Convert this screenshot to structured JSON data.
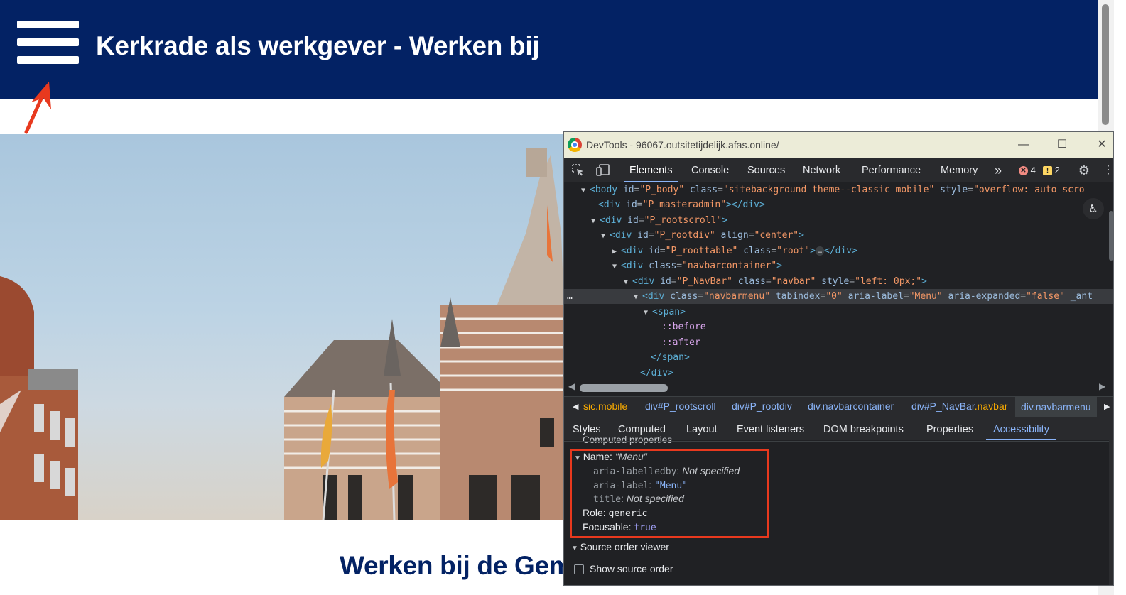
{
  "site": {
    "title": "Kerkrade als werkgever - Werken bij",
    "heading": "Werken bij de Gem",
    "header_color": "#032264"
  },
  "devtools": {
    "window_title": "DevTools - 96067.outsitetijdelijk.afas.online/",
    "window_buttons": {
      "minimize": "—",
      "maximize": "☐",
      "close": "✕"
    },
    "tabs": [
      "Elements",
      "Console",
      "Sources",
      "Network",
      "Performance",
      "Memory"
    ],
    "more_tabs": "»",
    "errors": "4",
    "warnings": "2",
    "dom": {
      "body": {
        "tag": "body",
        "id": "P_body",
        "class": "sitebackground  theme--classic mobile",
        "style": "overflow: auto scro"
      },
      "masteradmin": {
        "open": "<div ",
        "id_attr": "id=",
        "id_val": "\"P_masteradmin\"",
        "close": "></div>"
      },
      "rootscroll": {
        "id_val": "\"P_rootscroll\""
      },
      "rootdiv": {
        "id_val": "\"P_rootdiv\"",
        "align_val": "\"center\""
      },
      "roottable": {
        "id_val": "\"P_roottable\"",
        "class_val": "\"root\"",
        "ellipsis": "…"
      },
      "navbarcontainer": {
        "class_val": "\"navbarcontainer\""
      },
      "navbar": {
        "id_val": "\"P_NavBar\"",
        "class_val": "\"navbar\"",
        "style_val": "\"left: 0px;\""
      },
      "navbarmenu": {
        "class_val": "\"navbarmenu\"",
        "tabindex_val": "\"0\"",
        "aria_label_val": "\"Menu\"",
        "aria_expanded_val": "\"false\"",
        "trailing": " _ant"
      },
      "span_open": "<span>",
      "before": "::before",
      "after": "::after",
      "span_close": "</span>",
      "div_close": "</div>",
      "dots": "…"
    },
    "breadcrumbs": [
      {
        "prefix": "",
        "cls": "sic.mobile"
      },
      {
        "prefix": "div#P_rootscroll",
        "cls": ""
      },
      {
        "prefix": "div#P_rootdiv",
        "cls": ""
      },
      {
        "prefix": "div.navbarcontainer",
        "cls": ""
      },
      {
        "prefix": "div#P_NavBar",
        "cls": ".navbar"
      },
      {
        "prefix": "div.navbarmenu",
        "cls": ""
      }
    ],
    "panel_tabs": [
      "Styles",
      "Computed",
      "Layout",
      "Event listeners",
      "DOM breakpoints",
      "Properties",
      "Accessibility"
    ],
    "accessibility": {
      "section_cut": "Computed properties",
      "name_label": "Name: ",
      "name_value": "\"Menu\"",
      "aria_labelledby_key": "aria-labelledby",
      "aria_labelledby_value": "Not specified",
      "aria_label_key": "aria-label",
      "aria_label_value": "\"Menu\"",
      "title_key": "title",
      "title_value": "Not specified",
      "role_label": "Role: ",
      "role_value": "generic",
      "focusable_label": "Focusable: ",
      "focusable_value": "true",
      "source_order_viewer": "Source order viewer",
      "show_source_order": "Show source order"
    },
    "highlight_color": "#e8391e"
  }
}
